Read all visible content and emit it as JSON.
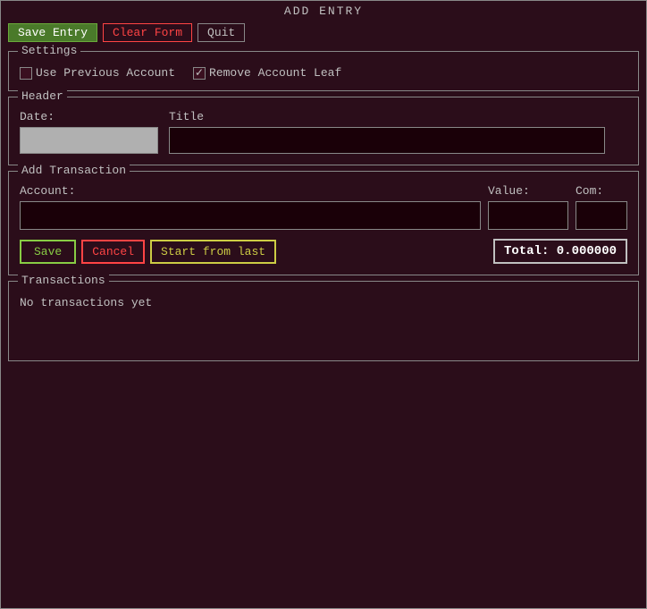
{
  "window": {
    "title": "ADD ENTRY"
  },
  "toolbar": {
    "save_entry_label": "Save Entry",
    "clear_form_label": "Clear Form",
    "quit_label": "Quit"
  },
  "settings": {
    "section_label": "Settings",
    "use_previous_account_label": "Use Previous Account",
    "use_previous_account_checked": false,
    "remove_account_leaf_label": "Remove Account Leaf",
    "remove_account_leaf_checked": true
  },
  "header": {
    "section_label": "Header",
    "date_label": "Date:",
    "date_value": "",
    "date_placeholder": "",
    "title_label": "Title",
    "title_value": "",
    "title_placeholder": ""
  },
  "add_transaction": {
    "section_label": "Add Transaction",
    "account_label": "Account:",
    "account_value": "",
    "account_placeholder": "",
    "value_label": "Value:",
    "value_value": "",
    "value_placeholder": "",
    "com_label": "Com:",
    "com_value": "",
    "com_placeholder": "",
    "save_btn": "Save",
    "cancel_btn": "Cancel",
    "start_from_last_btn": "Start from last",
    "total_label": "Total:",
    "total_value": "0.000000"
  },
  "transactions": {
    "section_label": "Transactions",
    "empty_message": "No transactions yet"
  }
}
